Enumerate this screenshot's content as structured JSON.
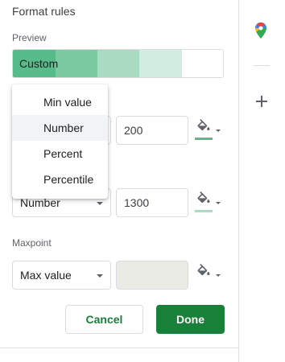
{
  "header": {
    "title": "Format rules"
  },
  "preview": {
    "label": "Preview",
    "text": "Custom",
    "colors": [
      "#57bb8a",
      "#7bcaa1",
      "#a8dbc1",
      "#d3ece0",
      "#ffffff"
    ]
  },
  "minpoint": {
    "type": "Number",
    "value": "200",
    "color": "#57bb8a"
  },
  "midpoint": {
    "type": "Number",
    "value": "1300",
    "color": "#abdbc3"
  },
  "maxpoint": {
    "label": "Maxpoint",
    "type": "Max value",
    "value": ""
  },
  "dropdown": {
    "options": [
      "Min value",
      "Number",
      "Percent",
      "Percentile"
    ],
    "selected": "Number"
  },
  "buttons": {
    "cancel": "Cancel",
    "done": "Done"
  },
  "sidebar": {
    "icons": [
      "maps-icon",
      "plus-icon"
    ]
  }
}
